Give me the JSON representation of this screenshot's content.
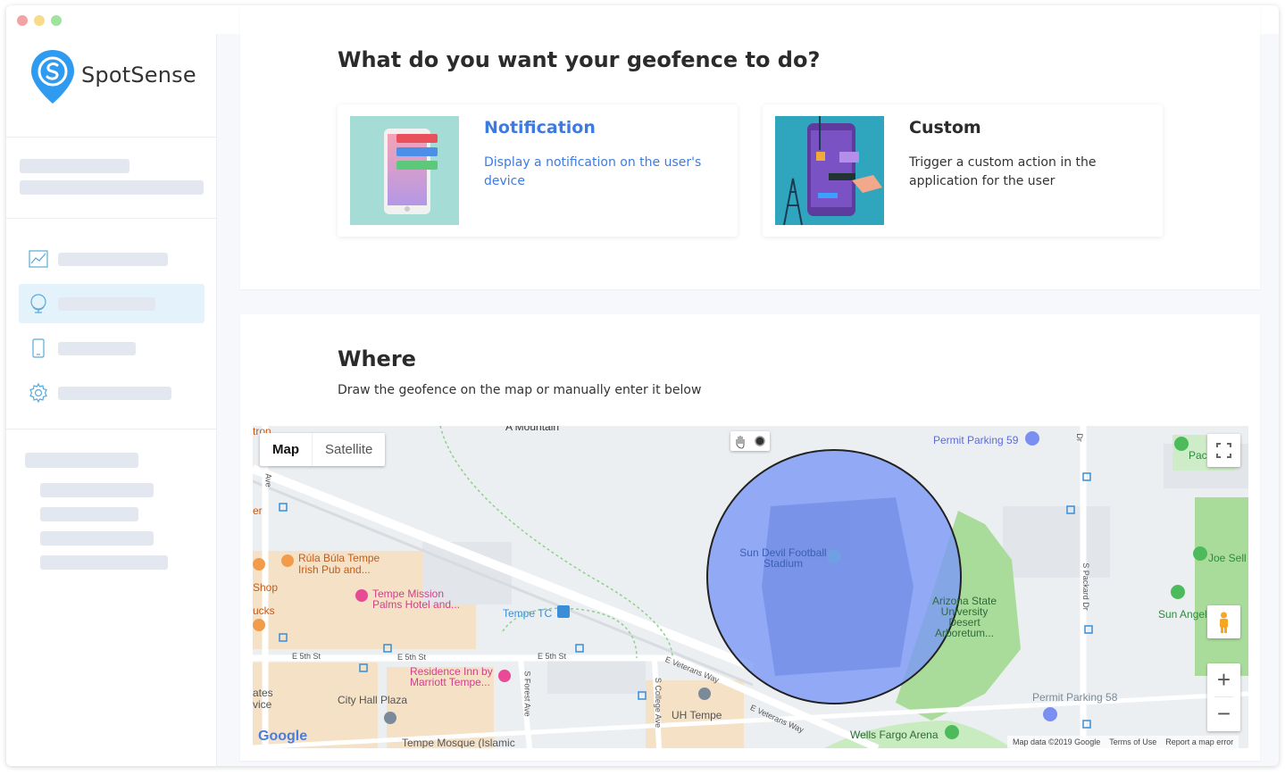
{
  "brand": {
    "name": "SpotSense",
    "accent": "#2e9bf0"
  },
  "sidebar": {
    "nav_icons": [
      "chart-icon",
      "globe-icon",
      "phone-icon",
      "gear-icon"
    ],
    "active_index": 1
  },
  "what_section": {
    "heading": "What do you want your geofence to do?",
    "options": [
      {
        "title": "Notification",
        "description": "Display a notification on the user's device",
        "selected": true,
        "color": "#3d7be3"
      },
      {
        "title": "Custom",
        "description": "Trigger a custom action in the application for the user",
        "selected": false,
        "color": "#2b2b2b"
      }
    ]
  },
  "where_section": {
    "heading": "Where",
    "subtitle": "Draw the geofence on the map or manually enter it below"
  },
  "map": {
    "tabs": [
      "Map",
      "Satellite"
    ],
    "active_tab": "Map",
    "zoom_in": "+",
    "zoom_out": "−",
    "geofence_color": "#7c98f6",
    "labels": {
      "stadium": "Sun Devil Football Stadium",
      "arboretum": "Arizona State University Desert Arboretum...",
      "permit59": "Permit Parking 59",
      "permit58": "Permit Parking 58",
      "wells": "Wells Fargo Arena",
      "uh_tempe": "UH Tempe",
      "city_hall": "City Hall Plaza",
      "tempe_tc": "Tempe TC",
      "rula": "Rúla Búla Tempe Irish Pub and...",
      "tempe_mission": "Tempe Mission Palms Hotel and...",
      "residence": "Residence Inn by Marriott Tempe...",
      "mosque": "Tempe Mosque (Islamic",
      "joe": "Joe Sell",
      "sun_angel": "Sun Angel",
      "pac": "Pac",
      "mountain": "A Mountain",
      "shop": "Shop",
      "ucks": "ucks",
      "ates": "ates",
      "vice": "vice",
      "tron": "tron",
      "er": "er"
    },
    "streets": {
      "e5th_a": "E 5th St",
      "e5th_b": "E 5th St",
      "e5th_c": "E 5th St",
      "veterans_a": "E Veterans Way",
      "veterans_b": "E Veterans Way",
      "forest": "S Forest Ave",
      "college": "S College Ave",
      "packard": "S Packard Dr",
      "ave": "Ave",
      "dr": "Dr"
    },
    "google_logo": "Google",
    "footer": {
      "map_data": "Map data ©2019 Google",
      "terms": "Terms of Use",
      "report": "Report a map error"
    }
  }
}
